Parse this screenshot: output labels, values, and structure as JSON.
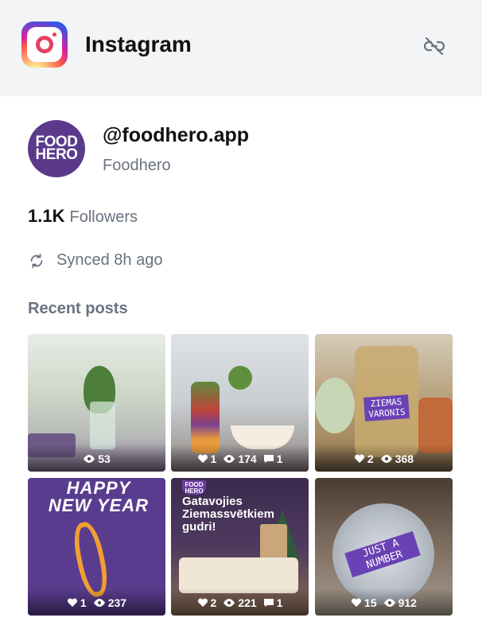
{
  "header": {
    "title": "Instagram",
    "logo_icon": "instagram-logo-icon",
    "action_icon": "unlink-icon"
  },
  "profile": {
    "avatar_line1": "FOOD",
    "avatar_line2": "HERO",
    "avatar_color": "#5b3a8c",
    "handle": "@foodhero.app",
    "display_name": "Foodhero"
  },
  "followers": {
    "count": "1.1K",
    "label": "Followers"
  },
  "sync": {
    "icon": "refresh-icon",
    "label": "Synced 8h ago"
  },
  "recent_posts": {
    "title": "Recent posts",
    "posts": [
      {
        "likes": null,
        "views": "53",
        "comments": null
      },
      {
        "likes": "1",
        "views": "174",
        "comments": "1"
      },
      {
        "likes": "2",
        "views": "368",
        "comments": null,
        "tag_text": "ZIEMAS VARONIS"
      },
      {
        "likes": "1",
        "views": "237",
        "comments": null,
        "overlay_text": "HAPPY NEW YEAR"
      },
      {
        "likes": "2",
        "views": "221",
        "comments": "1",
        "overlay_title": "Gatavojies Ziemassvētkiem gudri!",
        "logo_line1": "FOOD",
        "logo_line2": "HERO"
      },
      {
        "likes": "15",
        "views": "912",
        "comments": null,
        "tag_text": "JUST A NUMBER"
      }
    ]
  }
}
